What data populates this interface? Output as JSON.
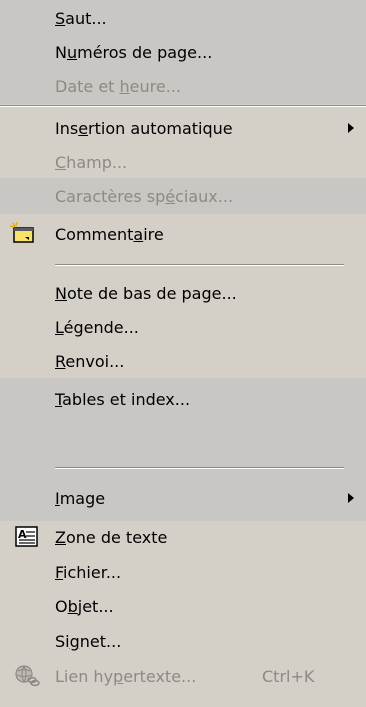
{
  "menu": {
    "items": [
      {
        "pre": "",
        "u": "S",
        "post": "aut..."
      },
      {
        "pre": "N",
        "u": "u",
        "post": "méros de page..."
      },
      {
        "pre": "Date et ",
        "u": "h",
        "post": "eure..."
      },
      {
        "pre": "Ins",
        "u": "e",
        "post": "rtion automatique"
      },
      {
        "pre": "",
        "u": "C",
        "post": "hamp..."
      },
      {
        "pre": "Caractères sp",
        "u": "é",
        "post": "ciaux..."
      },
      {
        "pre": "Comment",
        "u": "a",
        "post": "ire"
      },
      {
        "pre": "",
        "u": "N",
        "post": "ote de bas de page..."
      },
      {
        "pre": "",
        "u": "L",
        "post": "égende..."
      },
      {
        "pre": "",
        "u": "R",
        "post": "envoi..."
      },
      {
        "pre": "",
        "u": "T",
        "post": "ables et index..."
      },
      {
        "pre": "",
        "u": "I",
        "post": "mage"
      },
      {
        "pre": "",
        "u": "Z",
        "post": "one de texte"
      },
      {
        "pre": "",
        "u": "F",
        "post": "ichier..."
      },
      {
        "pre": "O",
        "u": "b",
        "post": "jet..."
      },
      {
        "pre": "Si",
        "u": "g",
        "post": "net..."
      },
      {
        "pre": "Lien hy",
        "u": "p",
        "post": "ertexte...",
        "shortcut": "Ctrl+K"
      }
    ]
  },
  "icons": {
    "comment": "comment-note-icon",
    "textbox": "text-box-icon",
    "hyperlink": "hyperlink-globe-icon"
  },
  "colors": {
    "menu_bg": "#d4d0c8",
    "disabled_text": "#8d8a85",
    "separator_dark": "#8e8b85"
  }
}
